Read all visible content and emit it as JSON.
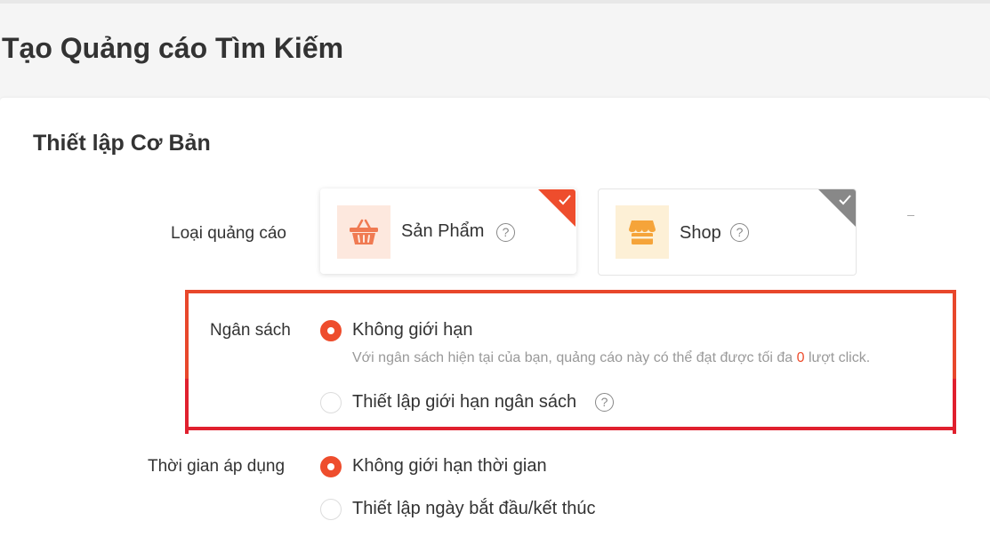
{
  "page": {
    "title": "Tạo Quảng cáo Tìm Kiếm"
  },
  "basic": {
    "section_title": "Thiết lập Cơ Bản",
    "ad_type": {
      "label": "Loại quảng cáo",
      "options": [
        {
          "name": "Sản Phẩm",
          "selected": true,
          "icon": "basket-icon"
        },
        {
          "name": "Shop",
          "selected": false,
          "icon": "shop-icon"
        }
      ],
      "help_glyph": "?"
    },
    "budget": {
      "label": "Ngân sách",
      "options": [
        {
          "label": "Không giới hạn",
          "selected": true
        },
        {
          "label": "Thiết lập giới hạn ngân sách",
          "selected": false
        }
      ],
      "hint_prefix": "Với ngân sách hiện tại của bạn, quảng cáo này có thể đạt được tối đa",
      "hint_value": "0",
      "hint_suffix": "lượt click."
    },
    "duration": {
      "label": "Thời gian áp dụng",
      "options": [
        {
          "label": "Không giới hạn thời gian",
          "selected": true
        },
        {
          "label": "Thiết lập ngày bắt đầu/kết thúc",
          "selected": false
        }
      ]
    }
  },
  "colors": {
    "accent": "#ee4d2d",
    "highlight": "#e0202e",
    "unselected_corner": "#888888"
  }
}
